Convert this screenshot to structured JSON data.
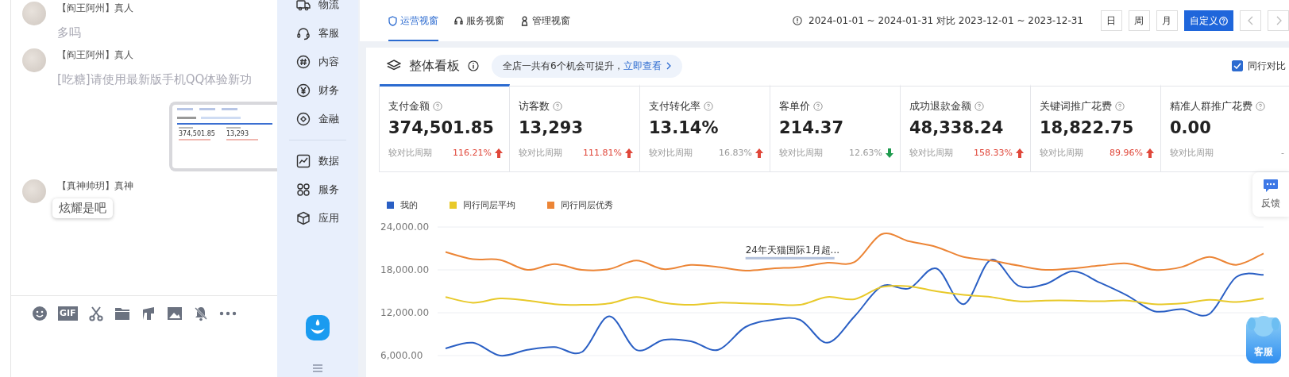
{
  "chat": {
    "messages": [
      {
        "sender": "【阎王阿州】真人",
        "text": "多吗",
        "kind": "plain"
      },
      {
        "sender": "【阎王阿州】真人",
        "text": "[吃糖]请使用最新版手机QQ体验新功",
        "kind": "plain",
        "preview": {
          "values": [
            "374,501.85",
            "13,293"
          ]
        }
      },
      {
        "sender": "【真神帅玥】真神",
        "text": "炫耀是吧",
        "kind": "bubble"
      }
    ],
    "toolbar": {
      "gif_label": "GIF"
    }
  },
  "sidebar": {
    "items": [
      {
        "label": "物流",
        "kind": "truck"
      },
      {
        "label": "客服",
        "kind": "headset"
      },
      {
        "label": "内容",
        "kind": "hash"
      },
      {
        "label": "财务",
        "kind": "yen"
      },
      {
        "label": "金融",
        "kind": "target"
      },
      {
        "label": "数据",
        "kind": "chart",
        "divider_before": true
      },
      {
        "label": "服务",
        "kind": "grid"
      },
      {
        "label": "应用",
        "kind": "cube"
      }
    ]
  },
  "tabs": [
    {
      "label": "运营视窗",
      "selected": true
    },
    {
      "label": "服务视窗",
      "selected": false
    },
    {
      "label": "管理视窗",
      "selected": false
    }
  ],
  "date_range": "2024-01-01 ~ 2024-01-31 对比 2023-12-01 ~ 2023-12-31",
  "period_buttons": [
    {
      "label": "日",
      "selected": false
    },
    {
      "label": "周",
      "selected": false
    },
    {
      "label": "月",
      "selected": false
    },
    {
      "label": "自定义",
      "selected": true
    }
  ],
  "board": {
    "title": "整体看板",
    "notice": "全店一共有6个机会可提升，",
    "notice_link": "立即查看",
    "compare": {
      "label": "同行对比",
      "checked": true
    }
  },
  "metrics": [
    {
      "label": "支付金额",
      "value": "374,501.85",
      "compare": "较对比周期",
      "change": "116.21%",
      "kind": "up",
      "highlight": true,
      "selected": true
    },
    {
      "label": "访客数",
      "value": "13,293",
      "compare": "较对比周期",
      "change": "111.81%",
      "kind": "up",
      "highlight": true,
      "selected": false
    },
    {
      "label": "支付转化率",
      "value": "13.14%",
      "compare": "较对比周期",
      "change": "16.83%",
      "kind": "up",
      "highlight": false,
      "selected": false
    },
    {
      "label": "客单价",
      "value": "214.37",
      "compare": "较对比周期",
      "change": "12.63%",
      "kind": "down",
      "highlight": false,
      "selected": false
    },
    {
      "label": "成功退款金额",
      "value": "48,338.24",
      "compare": "较对比周期",
      "change": "158.33%",
      "kind": "up",
      "highlight": true,
      "selected": false
    },
    {
      "label": "关键词推广花费",
      "value": "18,822.75",
      "compare": "较对比周期",
      "change": "89.96%",
      "kind": "up",
      "highlight": true,
      "selected": false
    },
    {
      "label": "精准人群推广花费",
      "value": "0.00",
      "compare": "较对比周期",
      "change": "-",
      "kind": "flat",
      "highlight": false,
      "selected": false
    }
  ],
  "chart": {
    "chart_data": {
      "type": "line",
      "grid": true,
      "ylim": [
        6000,
        24000
      ],
      "yticks": [
        {
          "value": 6000,
          "label": "6,000.00"
        },
        {
          "value": 12000,
          "label": "12,000.00"
        },
        {
          "value": 18000,
          "label": "18,000.00"
        },
        {
          "value": 24000,
          "label": "24,000.00"
        }
      ],
      "series": [
        {
          "name": "我的",
          "color": "#2a5fc4",
          "values": [
            7000,
            7800,
            6000,
            6800,
            7200,
            6500,
            11500,
            6800,
            8200,
            8000,
            6800,
            10000,
            11000,
            11000,
            7800,
            11500,
            15700,
            15400,
            18200,
            13200,
            19400,
            15800,
            16000,
            17800,
            16200,
            14400,
            12200,
            12500,
            11800,
            17000,
            17300
          ]
        },
        {
          "name": "同行同层平均",
          "color": "#e8c92a",
          "values": [
            14200,
            13400,
            14000,
            13700,
            13200,
            13100,
            13300,
            14200,
            13400,
            13100,
            13400,
            13300,
            13200,
            13100,
            14200,
            13900,
            15600,
            15700,
            15000,
            14500,
            14200,
            13600,
            13700,
            13700,
            13600,
            13700,
            13200,
            13300,
            13800,
            13500,
            14000
          ]
        },
        {
          "name": "同行同层优秀",
          "color": "#ec8536",
          "values": [
            20500,
            19500,
            19400,
            18000,
            18800,
            18000,
            18100,
            19300,
            18100,
            18700,
            18400,
            17900,
            18200,
            18400,
            19000,
            19100,
            23000,
            22000,
            21200,
            19800,
            19300,
            18600,
            18000,
            18200,
            18600,
            18900,
            18000,
            18400,
            19800,
            18700,
            20300
          ]
        }
      ],
      "annotations": [
        "24年天猫国际1月超..."
      ]
    }
  },
  "float": {
    "feedback": "反馈",
    "service": "客服"
  }
}
